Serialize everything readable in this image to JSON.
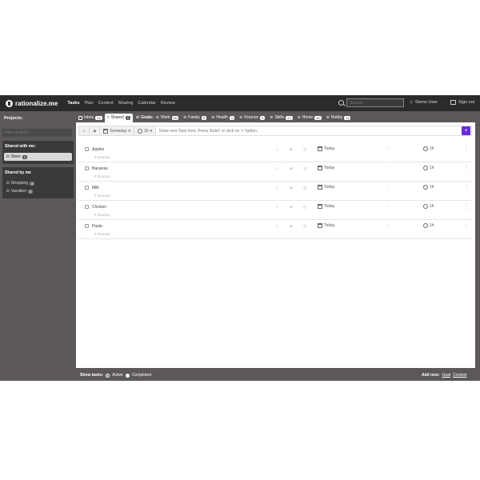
{
  "app": {
    "name": "rationalize.me"
  },
  "nav": {
    "items": [
      "Tasks",
      "Plan",
      "Context",
      "Sharing",
      "Calendar",
      "Review"
    ],
    "active": "Tasks"
  },
  "search": {
    "placeholder": "Search..."
  },
  "user": {
    "name": "Demo User",
    "signout": "Sign out"
  },
  "sidebar": {
    "projects_label": "Projects:",
    "filter_placeholder": "Filter projects",
    "shared_with_me": {
      "title": "Shared with me:",
      "items": [
        {
          "label": "Store",
          "count": "5",
          "selected": true
        }
      ]
    },
    "shared_by_me": {
      "title": "Shared by me",
      "items": [
        {
          "label": "Shopping",
          "count": "4"
        },
        {
          "label": "Vacation",
          "count": "3"
        }
      ]
    }
  },
  "tabs": {
    "inbox": {
      "label": "Inbox",
      "count": "13"
    },
    "shared": {
      "label": "Shared",
      "count": "5"
    },
    "goals_label": "Goals:",
    "goals": [
      {
        "label": "Work",
        "count": "26"
      },
      {
        "label": "Family",
        "count": "5"
      },
      {
        "label": "Health",
        "count": "3"
      },
      {
        "label": "Finance",
        "count": "6"
      },
      {
        "label": "Skills",
        "count": "21"
      },
      {
        "label": "Home",
        "count": "16"
      },
      {
        "label": "Hobby",
        "count": "11"
      }
    ]
  },
  "addbar": {
    "when": "Someday",
    "duration": "1h",
    "placeholder": "Enter new Task here. Press 'Enter' or click on '+' button.",
    "add": "+"
  },
  "tasks": [
    {
      "name": "Apples",
      "project": "# Grocery",
      "date": "Today",
      "duration": "1h"
    },
    {
      "name": "Bananas",
      "project": "# Grocery",
      "date": "Today",
      "duration": "1h"
    },
    {
      "name": "Milk",
      "project": "# Grocery",
      "date": "Today",
      "duration": "1h"
    },
    {
      "name": "Chicken",
      "project": "# Grocery",
      "date": "Today",
      "duration": "1h"
    },
    {
      "name": "Pasta",
      "project": "# Grocery",
      "date": "Today",
      "duration": "1h"
    }
  ],
  "footer": {
    "show_label": "Show tasks:",
    "active": "Active",
    "completed": "Completed",
    "add_new": "Add new:",
    "goal": "Goal",
    "context": "Context"
  },
  "colors": {
    "accent": "#6a2bd9",
    "topbar": "#2b2b2b",
    "background": "#5c5858"
  }
}
